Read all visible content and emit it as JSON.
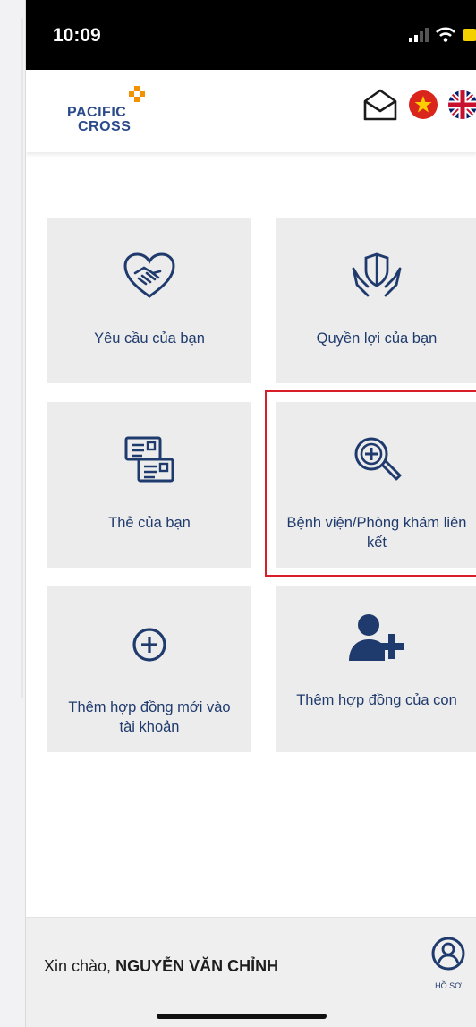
{
  "status_bar": {
    "time": "10:09"
  },
  "header": {
    "logo": {
      "line1": "PACIFIC",
      "line2": "CROSS"
    },
    "icons": [
      "mail-icon",
      "vietnam-flag-icon",
      "uk-flag-icon"
    ]
  },
  "menu": {
    "tiles": [
      {
        "label": "Yêu cầu của bạn",
        "icon": "handshake-heart-icon"
      },
      {
        "label": "Quyền lợi của bạn",
        "icon": "shield-hands-icon"
      },
      {
        "label": "Thẻ của bạn",
        "icon": "cards-icon"
      },
      {
        "label": "Bệnh viện/Phòng khám liên kết",
        "icon": "medical-search-icon"
      },
      {
        "label": "Thêm hợp đồng mới vào tài khoản",
        "icon": "plus-circle-icon"
      },
      {
        "label": "Thêm hợp đồng của con",
        "icon": "add-person-icon"
      }
    ]
  },
  "footer": {
    "greeting_prefix": "Xin chào,",
    "user_name": "NGUYỄN VĂN CHỈNH",
    "profile_label": "HỒ SƠ"
  },
  "colors": {
    "primary": "#1f3a6c",
    "tile_bg": "#ececec",
    "highlight": "#d81e2a"
  }
}
